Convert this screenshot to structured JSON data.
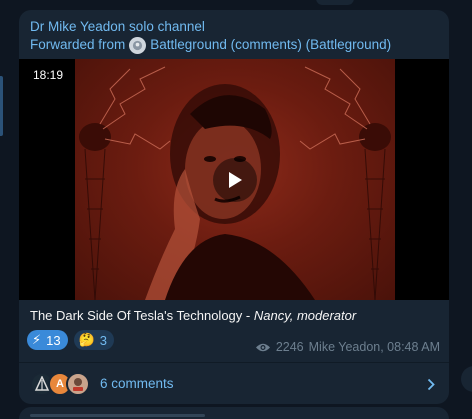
{
  "post": {
    "channel_name": "Dr Mike Yeadon solo channel",
    "forwarded_prefix": "Forwarded from",
    "forwarded_source": "Battleground (comments) (Battleground)",
    "video": {
      "duration": "18:19",
      "play_icon": "play-icon"
    },
    "caption": {
      "title": "The Dark Side Of Tesla's Technology - ",
      "author_italic": "Nancy, moderator"
    },
    "reactions": [
      {
        "emoji": "⚡",
        "count": "13",
        "active": true
      },
      {
        "emoji": "🤔",
        "count": "3",
        "active": false
      }
    ],
    "meta": {
      "views": "2246",
      "signature": "Mike Yeadon, 08:48 AM"
    },
    "comments": {
      "label": "6 comments",
      "avatar_letters": [
        "",
        "A",
        ""
      ]
    }
  },
  "colors": {
    "bg": "#0e1621",
    "bubble": "#182533",
    "accent": "#71baf0",
    "reaction_active": "#3a8ad9",
    "meta_text": "#6d7f8f"
  }
}
